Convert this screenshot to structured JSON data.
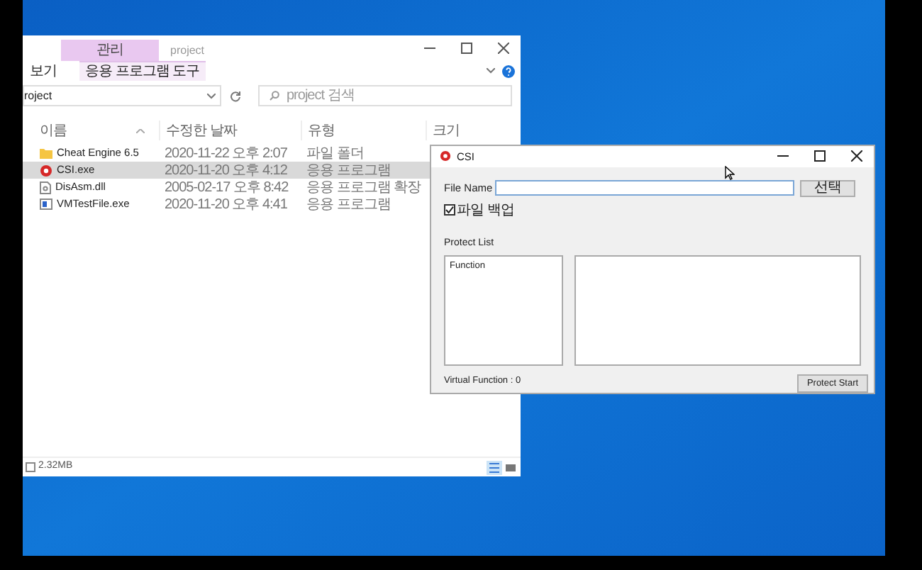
{
  "explorer": {
    "context_tab": "관리",
    "title": "project",
    "ribbon_tabs": [
      {
        "label": "보기",
        "selected": false
      },
      {
        "label": "응용 프로그램 도구",
        "selected": true
      }
    ],
    "address": "roject",
    "search": {
      "placeholder": "project 검색"
    },
    "columns": [
      "이름",
      "수정한 날짜",
      "유형",
      "크기"
    ],
    "rows": [
      {
        "kind": "folder",
        "name": "Cheat Engine 6.5",
        "date": "2020-11-22 오후 2:07",
        "type": "파일 폴더",
        "selected": false
      },
      {
        "kind": "app",
        "name": "CSI.exe",
        "date": "2020-11-20 오후 4:12",
        "type": "응용 프로그램",
        "selected": true
      },
      {
        "kind": "dll",
        "name": "DisAsm.dll",
        "date": "2005-02-17 오후 8:42",
        "type": "응용 프로그램 확장",
        "selected": false
      },
      {
        "kind": "exe",
        "name": "VMTestFile.exe",
        "date": "2020-11-20 오후 4:41",
        "type": "응용 프로그램",
        "selected": false
      }
    ],
    "status": "2.32MB"
  },
  "csi": {
    "title": "CSI",
    "file_name_label": "File Name",
    "browse_button": "선택",
    "backup": {
      "label": "파일 백업",
      "checked": true
    },
    "protect_list_label": "Protect List",
    "function_list": [
      "Function"
    ],
    "virtual_function": "Virtual Function : 0",
    "start_button": "Protect Start"
  }
}
